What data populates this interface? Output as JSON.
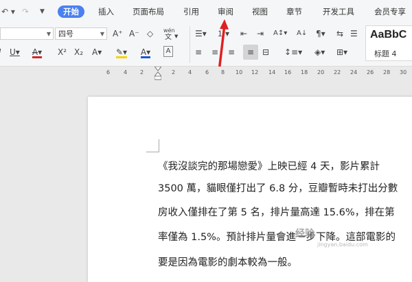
{
  "menu": {
    "tabs": [
      "开始",
      "插入",
      "页面布局",
      "引用",
      "审阅",
      "视图",
      "章节",
      "开发工具",
      "会员专享"
    ]
  },
  "ribbon": {
    "font_name": "",
    "font_size": "四号",
    "grow_font": "A⁺",
    "shrink_font": "A⁻",
    "phonetic": "wén",
    "superscript": "X²",
    "subscript": "X₂",
    "style_sample": "AaBbC",
    "style_name": "标题 4"
  },
  "ruler": {
    "numbers": [
      "6",
      "4",
      "2",
      "2",
      "4",
      "6",
      "8",
      "10",
      "12",
      "14",
      "16",
      "18",
      "20",
      "22",
      "24",
      "26",
      "28",
      "30"
    ]
  },
  "document": {
    "lines": [
      "《我沒談完的那場戀愛》上映已經 4 天，影片累計",
      "3500 萬，貓眼僅打出了 6.8 分，豆瓣暫時未打出分數",
      "房收入僅排在了第 5 名，排片量高達 15.6%，排在第",
      "率僅為 1.5%。預計排片量會進一步下降。這部電影的",
      "要是因為電影的劇本較為一般。"
    ]
  },
  "watermark": {
    "main": "经验",
    "sub": "jingyan.baidu.com"
  },
  "colors": {
    "accent": "#4a80f0",
    "font_color": "#1a56db",
    "highlight": "#f5d400",
    "annotation_arrow": "#e02020",
    "red_text": "#d6242a"
  }
}
